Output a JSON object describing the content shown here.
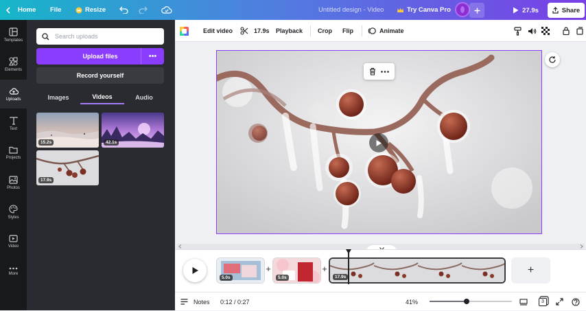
{
  "topbar": {
    "home": "Home",
    "file": "File",
    "resize": "Resize",
    "doc_title": "Untitled design - Video",
    "try_pro": "Try Canva Pro",
    "duration": "27.9s",
    "share": "Share"
  },
  "rail": [
    {
      "label": "Templates",
      "icon": "templates-icon"
    },
    {
      "label": "Elements",
      "icon": "elements-icon"
    },
    {
      "label": "Uploads",
      "icon": "uploads-icon"
    },
    {
      "label": "Text",
      "icon": "text-icon"
    },
    {
      "label": "Projects",
      "icon": "projects-icon"
    },
    {
      "label": "Photos",
      "icon": "photos-icon"
    },
    {
      "label": "Styles",
      "icon": "styles-icon"
    },
    {
      "label": "Video",
      "icon": "video-icon"
    },
    {
      "label": "More",
      "icon": "more-icon"
    }
  ],
  "panel": {
    "search_placeholder": "Search uploads",
    "upload_label": "Upload files",
    "more_label": "•••",
    "record_label": "Record yourself",
    "tabs": [
      "Images",
      "Videos",
      "Audio"
    ],
    "active_tab": "Videos",
    "videos": [
      {
        "duration": "15.2s",
        "name": "snowy-landscape-thumbnail"
      },
      {
        "duration": "42.1s",
        "name": "purple-sunset-thumbnail"
      },
      {
        "duration": "17.9s",
        "name": "frozen-berries-thumbnail"
      }
    ]
  },
  "context_toolbar": {
    "edit_video": "Edit video",
    "trim_duration": "17.9s",
    "playback": "Playback",
    "crop": "Crop",
    "flip": "Flip",
    "animate": "Animate"
  },
  "timeline": {
    "clips": [
      {
        "duration": "5.0s"
      },
      {
        "duration": "5.0s"
      },
      {
        "duration": "17.9s"
      }
    ],
    "add_label": "+"
  },
  "bottom": {
    "notes": "Notes",
    "time": "0:12 / 0:27",
    "zoom": "41%",
    "zoom_fraction": 0.45,
    "page_count": "3"
  },
  "colors": {
    "accent": "#8b3dff",
    "rail_bg": "#18191b",
    "panel_bg": "#2a2b30"
  }
}
